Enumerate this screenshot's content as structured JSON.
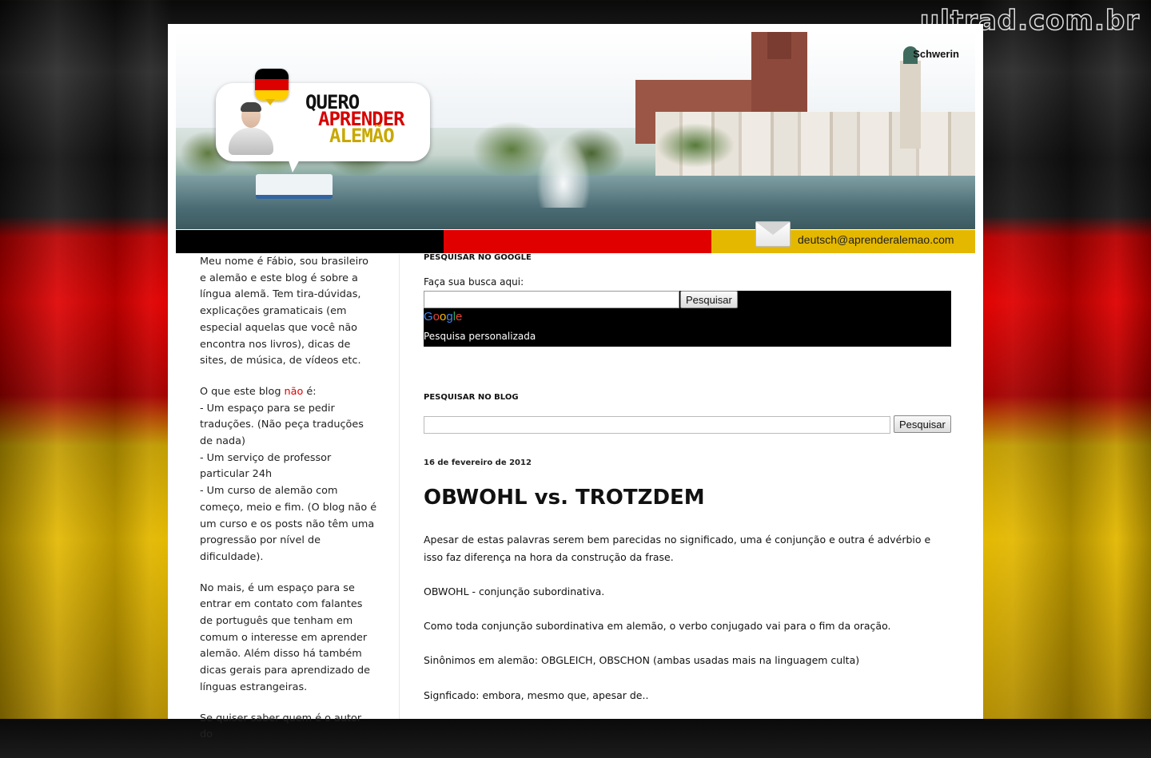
{
  "watermark": "ultrad.com.br",
  "header": {
    "logo_line1": "QUERO",
    "logo_line2": "APRENDER",
    "logo_line3": "ALEMÃO",
    "city_label": "Schwerin",
    "email": "deutsch@aprenderalemao.com",
    "flag_colors": [
      "#000000",
      "#dd0000",
      "#ffce00"
    ]
  },
  "sidebar": {
    "intro": "Meu nome é Fábio, sou brasileiro e alemão e este blog é sobre a língua alemã. Tem tira-dúvidas, explicações gramaticais (em especial aquelas que você não encontra nos livros), dicas de sites, de música, de vídeos etc.",
    "not_prefix": "O que este blog ",
    "not_word": "não",
    "not_suffix": " é:",
    "not_item1": "- Um espaço para se pedir traduções. (Não peça traduções de nada)",
    "not_item2": "- Um serviço de professor particular 24h",
    "not_item3": "- Um curso de alemão com começo, meio e fim. (O blog não é um curso e os posts não têm uma progressão por nível de dificuldade).",
    "contact": "No mais, é um espaço para se entrar em contato com falantes de português que tenham em comum o interesse em aprender alemão. Além disso há também dicas gerais para aprendizado de línguas estrangeiras.",
    "author_partial": "Se quiser saber quem é o autor do"
  },
  "google_search": {
    "title": "PESQUISAR NO GOOGLE",
    "label": "Faça sua busca aqui:",
    "input_value": "",
    "button": "Pesquisar",
    "logo": "Google",
    "custom_label": "Pesquisa personalizada"
  },
  "blog_search": {
    "title": "PESQUISAR NO BLOG",
    "input_value": "",
    "button": "Pesquisar"
  },
  "post": {
    "date": "16 de fevereiro de 2012",
    "title": "OBWOHL vs. TROTZDEM",
    "paragraphs": [
      "Apesar de estas palavras serem bem parecidas no significado, uma é conjunção e outra é advérbio e isso faz diferença na hora da construção da frase.",
      "OBWOHL - conjunção subordinativa.",
      "Como toda conjunção subordinativa em alemão, o verbo conjugado vai para o fim da oração.",
      "Sinônimos em alemão: OBGLEICH, OBSCHON (ambas usadas mais na linguagem culta)",
      "Signficado: embora, mesmo que, apesar de.."
    ]
  }
}
